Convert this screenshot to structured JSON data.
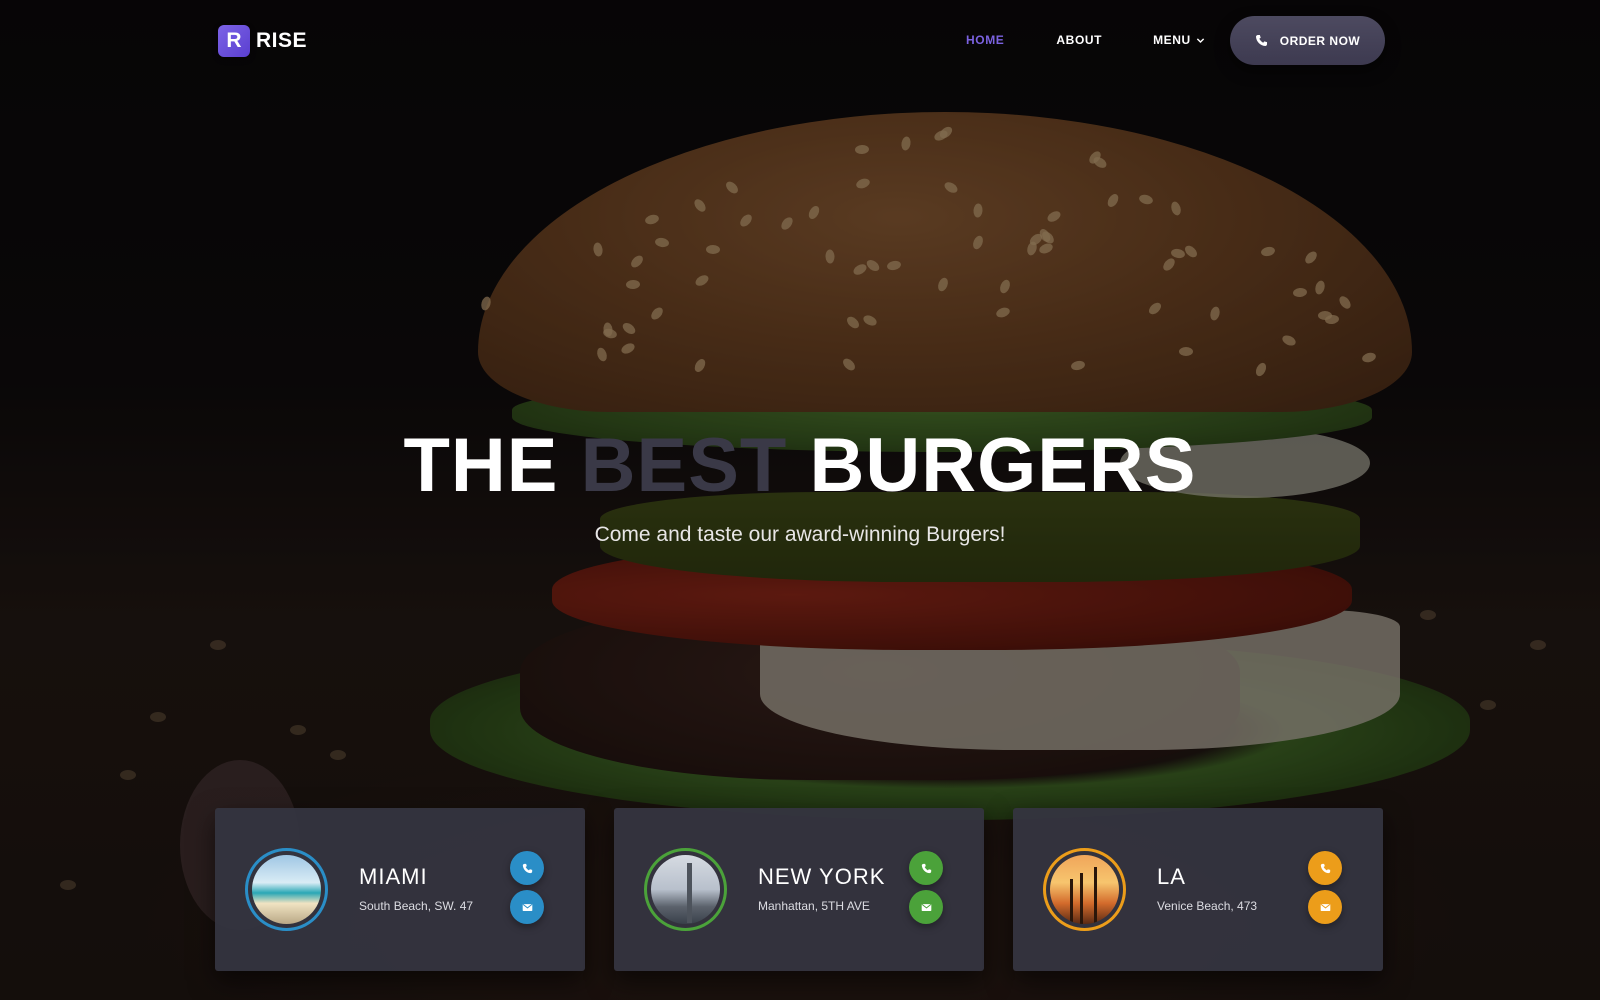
{
  "brand": {
    "logo_letter": "R",
    "name": "RISE",
    "accent": "#7b62e0"
  },
  "nav": {
    "items": [
      {
        "label": "HOME",
        "active": true
      },
      {
        "label": "ABOUT",
        "active": false
      },
      {
        "label": "MENU",
        "active": false,
        "icon": "chevron-down-icon"
      }
    ],
    "cta": {
      "label": "ORDER NOW",
      "icon": "phone-icon"
    }
  },
  "hero": {
    "title_part1": "THE",
    "title_highlight": "BEST",
    "title_part2": "BURGERS",
    "subtitle": "Come and taste our award-winning Burgers!"
  },
  "locations": [
    {
      "city": "MIAMI",
      "address": "South Beach, SW. 47",
      "color": "#2a8ec7",
      "photo": "miami-beach-photo"
    },
    {
      "city": "NEW YORK",
      "address": "Manhattan, 5TH AVE",
      "color": "#4ba23a",
      "photo": "new-york-skyline-photo"
    },
    {
      "city": "LA",
      "address": "Venice Beach, 473",
      "color": "#ec9d1a",
      "photo": "la-palm-trees-photo"
    }
  ]
}
